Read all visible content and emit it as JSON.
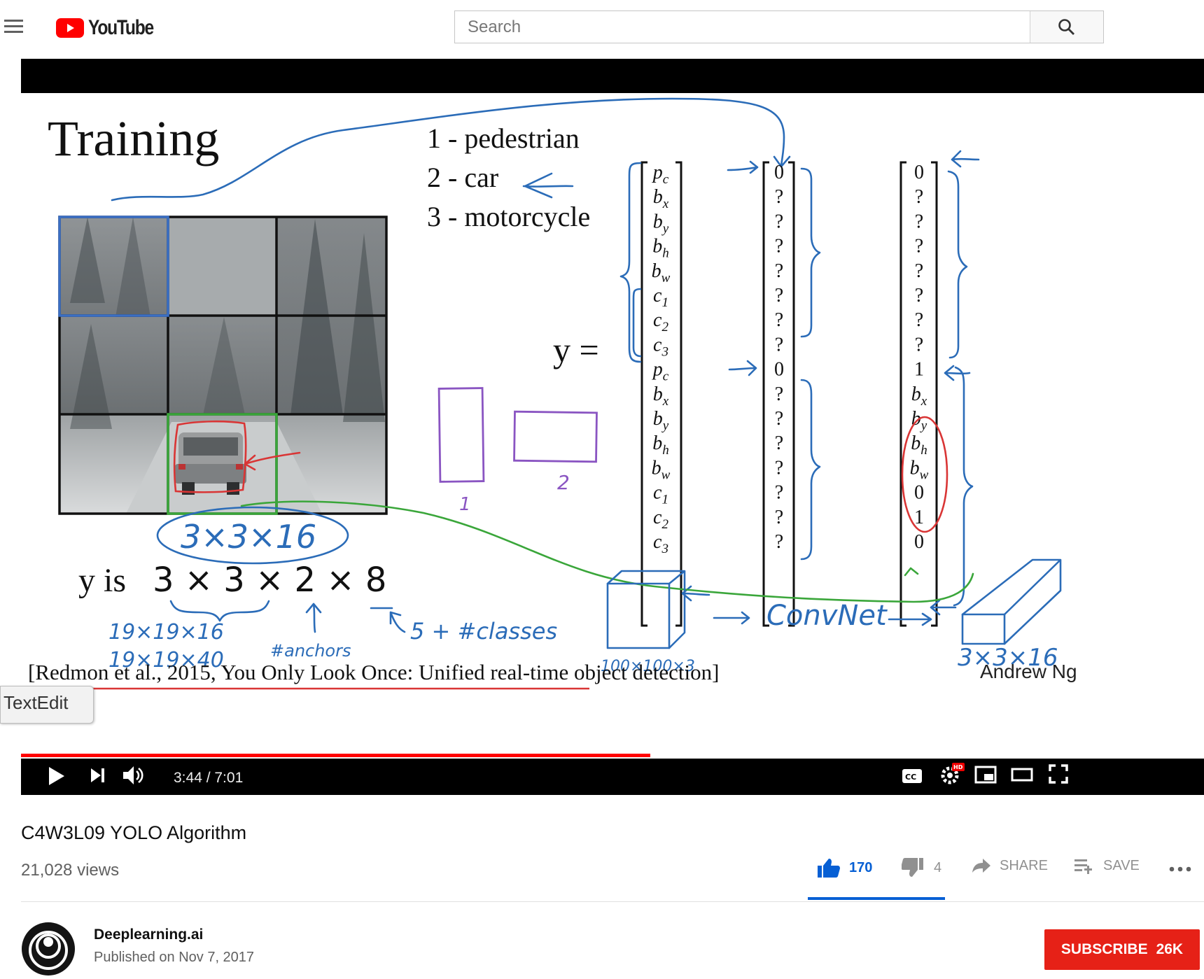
{
  "header": {
    "logo_text": "YouTube",
    "search_placeholder": "Search",
    "icons": [
      "menu-icon",
      "youtube-logo-icon",
      "search-icon"
    ]
  },
  "slide": {
    "title": "Training",
    "classes": [
      "1 -  pedestrian",
      "2 -  car",
      "3 -  motorcycle"
    ],
    "y_equals": "y  =",
    "y_is_prefix": "y  is",
    "y_is_dims": "3 × 3 × 2 × 8",
    "citation": "[Redmon et al., 2015, You Only Look Once: Unified real-time object detection]",
    "author": "Andrew Ng",
    "vector_labels": [
      "pc",
      "bx",
      "by",
      "bh",
      "bw",
      "c1",
      "c2",
      "c3",
      "pc",
      "bx",
      "by",
      "bh",
      "bw",
      "c1",
      "c2",
      "c3"
    ],
    "vector_mid": [
      "0",
      "?",
      "?",
      "?",
      "?",
      "?",
      "?",
      "?",
      "0",
      "?",
      "?",
      "?",
      "?",
      "?",
      "?",
      "?"
    ],
    "vector_right": [
      "0",
      "?",
      "?",
      "?",
      "?",
      "?",
      "?",
      "?",
      "1",
      "bx",
      "by",
      "bh",
      "bw",
      "0",
      "1",
      "0"
    ],
    "handwriting": {
      "circled": "3×3×16",
      "grid_19_a": "19×19×16",
      "grid_19_b": "19×19×40",
      "anchors": "#anchors",
      "classes": "5 + #classes",
      "anchor_1": "1",
      "anchor_2": "2",
      "input_dims": "100×100×3",
      "convnet": "ConvNet",
      "output_dims": "3×3×16"
    }
  },
  "player": {
    "time": "3:44 / 7:01",
    "progress": 0.532,
    "hd_badge": "HD",
    "tooltip": "TextEdit",
    "icons": [
      "play-icon",
      "next-icon",
      "volume-icon",
      "captions-icon",
      "settings-icon",
      "miniplayer-icon",
      "theater-icon",
      "fullscreen-icon"
    ]
  },
  "video": {
    "title": "C4W3L09 YOLO Algorithm",
    "views": "21,028 views",
    "likes": "170",
    "dislikes": "4",
    "share_label": "SHARE",
    "save_label": "SAVE"
  },
  "channel": {
    "name": "Deeplearning.ai",
    "published": "Published on Nov 7, 2017",
    "subscribe_label": "SUBSCRIBE",
    "subscriber_count": "26K"
  },
  "colors": {
    "youtube_red": "#ff0000",
    "subscribe_red": "#e62117",
    "link_blue": "#065fd4",
    "handwriting_blue": "#2b6cb8",
    "handwriting_red": "#d93535",
    "handwriting_green": "#3aa63a",
    "handwriting_purple": "#8a55c2"
  }
}
